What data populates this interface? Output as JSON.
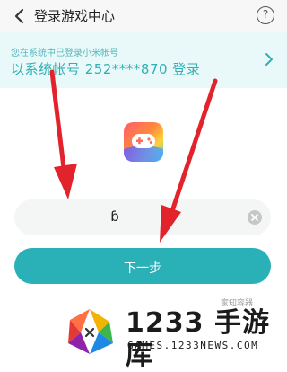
{
  "header": {
    "title": "登录游戏中心",
    "help_label": "?"
  },
  "banner": {
    "subtitle": "您在系统中已登录小米帐号",
    "main_text": "以系统帐号 252****870 登录"
  },
  "input": {
    "value": "ɓ"
  },
  "next_button": {
    "label": "下一步"
  },
  "hint": "家知容器",
  "watermark": {
    "title": "1233 手游库",
    "subtitle": "GAMES.1233NEWS.COM"
  },
  "colors": {
    "accent": "#2ab0b7",
    "arrow": "#e3232b",
    "banner_bg": "#e9f8f8"
  }
}
